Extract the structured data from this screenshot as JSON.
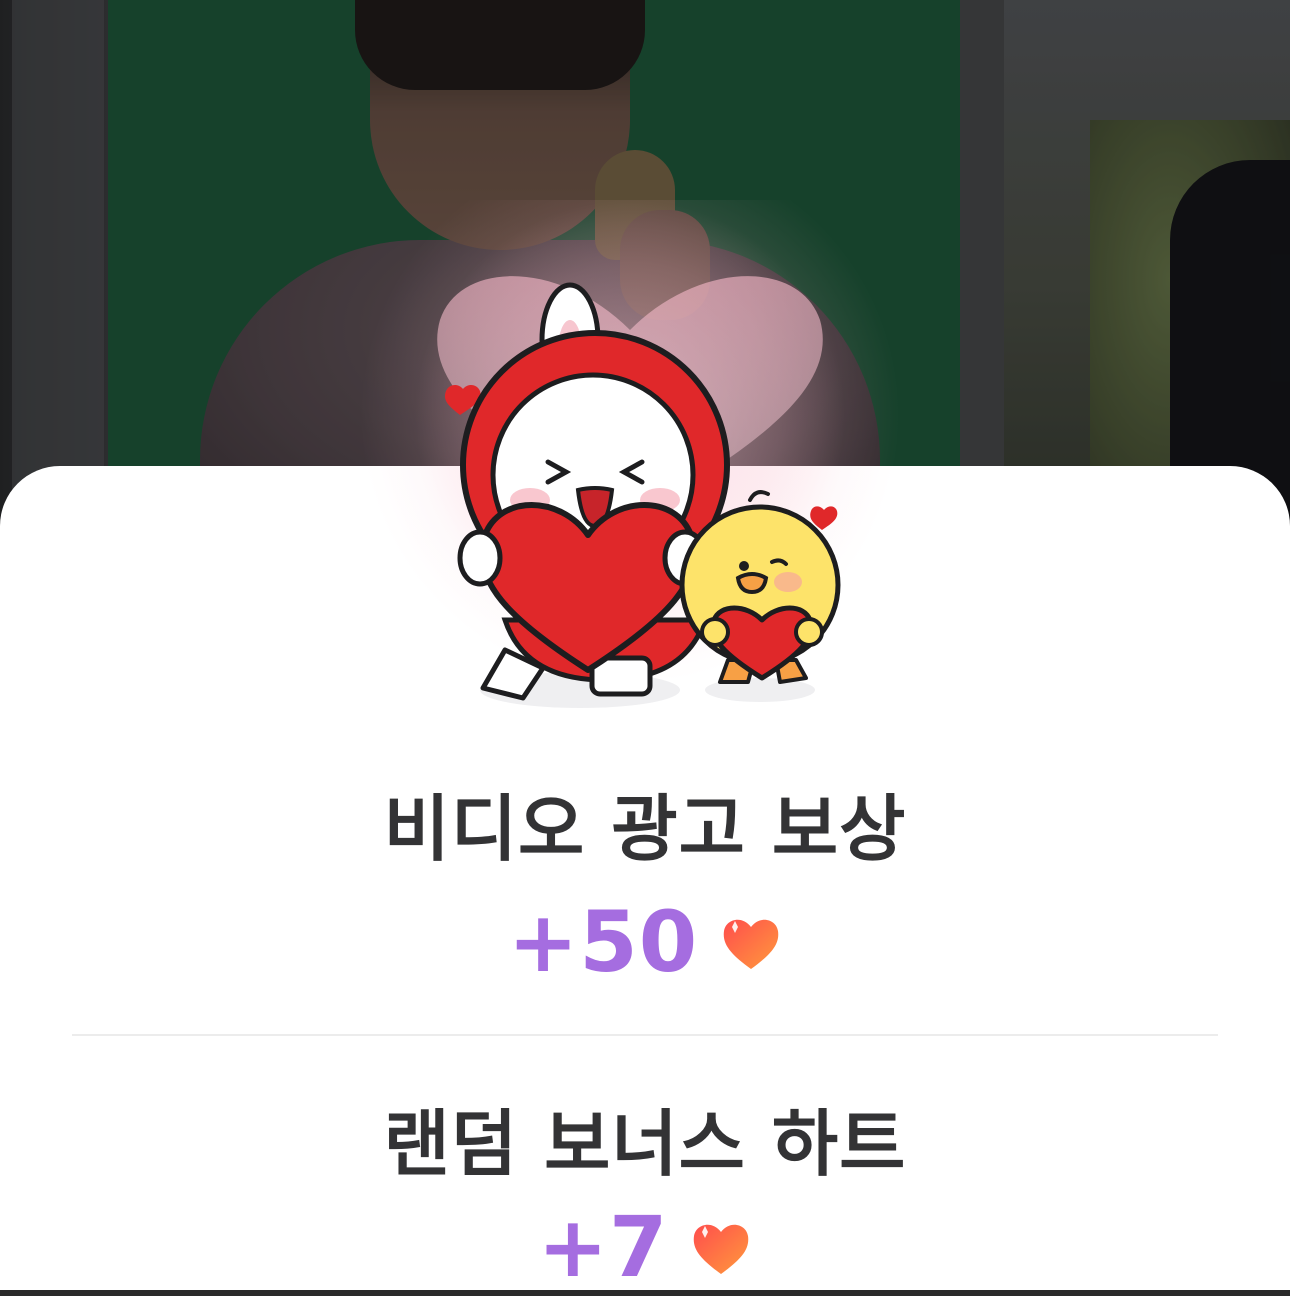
{
  "reward_popup": {
    "rows": [
      {
        "title": "비디오 광고 보상",
        "amount": "+50",
        "icon": "heart-icon"
      },
      {
        "title": "랜덤 보너스 하트",
        "amount": "+7",
        "icon": "heart-icon"
      }
    ]
  },
  "illustration": {
    "name": "rabbit-and-chick-holding-hearts"
  },
  "colors": {
    "amount_text": "#a56de0",
    "title_text": "#333335",
    "heart_red": "#e0282a",
    "heart_gradient_start": "#ff4d4d",
    "heart_gradient_end": "#ff9a3c",
    "sheet_background": "#ffffff"
  }
}
